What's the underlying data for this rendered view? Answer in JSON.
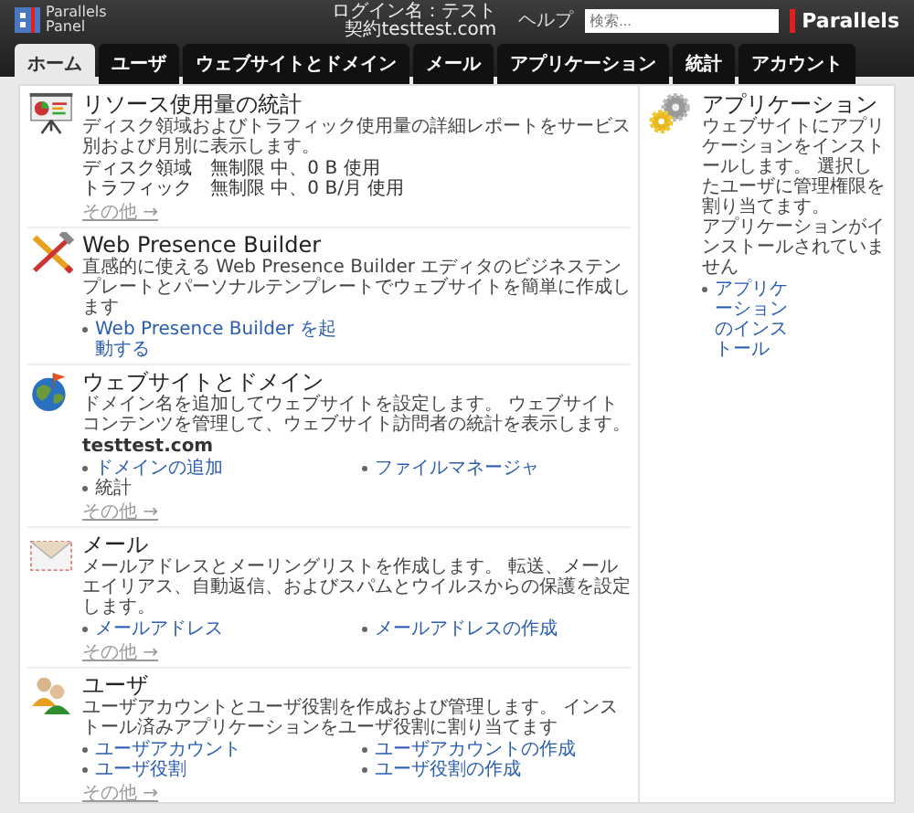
{
  "header": {
    "logo_line1": "Parallels",
    "logo_line2": "Panel",
    "login": "ログイン名：テスト",
    "account": "契約testtest.com",
    "help": "ヘルプ",
    "search": {
      "placeholder": "検索..."
    },
    "brand": "Parallels"
  },
  "tabs": [
    {
      "label": "ホーム",
      "selected": true
    },
    {
      "label": "ユーザ",
      "selected": false
    },
    {
      "label": "ウェブサイトとドメイン",
      "selected": false
    },
    {
      "label": "メール",
      "selected": false
    },
    {
      "label": "アプリケーション",
      "selected": false
    },
    {
      "label": "統計",
      "selected": false
    },
    {
      "label": "アカウント",
      "selected": false
    }
  ],
  "left": [
    {
      "kind": "stats",
      "title": "リソース使用量の統計",
      "description": "ディスク領域およびトラフィック使用量の詳細レポートをサービス別および月別に表示します。",
      "stats": [
        {
          "label": "ディスク領域",
          "value": "無制限 中、0 B 使用"
        },
        {
          "label": "トラフィック",
          "value": "無制限 中、0 B/月 使用"
        }
      ],
      "more": "その他 →"
    },
    {
      "kind": "tools",
      "title": "Web Presence Builder",
      "description": "直感的に使える Web Presence Builder エディタのビジネステンプレートとパーソナルテンプレートでウェブサイトを簡単に作成します",
      "links": [
        {
          "label": "Web Presence Builder を起動する",
          "link": true
        }
      ]
    },
    {
      "kind": "globe",
      "title": "ウェブサイトとドメイン",
      "description": "ドメイン名を追加してウェブサイトを設定します。 ウェブサイトコンテンツを管理して、ウェブサイト訪問者の統計を表示します。",
      "domain": "testtest.com",
      "links": [
        {
          "label": "ドメインの追加",
          "link": true
        },
        {
          "label": "ファイルマネージャ",
          "link": true
        },
        {
          "label": "統計",
          "link": false
        }
      ],
      "more": "その他 →"
    },
    {
      "kind": "mail",
      "title": "メール",
      "description": "メールアドレスとメーリングリストを作成します。 転送、メールエイリアス、自動返信、およびスパムとウイルスからの保護を設定します。",
      "links": [
        {
          "label": "メールアドレス",
          "link": true
        },
        {
          "label": "メールアドレスの作成",
          "link": true
        }
      ],
      "more": "その他 →"
    },
    {
      "kind": "users",
      "title": "ユーザ",
      "description": "ユーザアカウントとユーザ役割を作成および管理します。 インストール済みアプリケーションをユーザ役割に割り当てます",
      "links": [
        {
          "label": "ユーザアカウント",
          "link": true
        },
        {
          "label": "ユーザアカウントの作成",
          "link": true
        },
        {
          "label": "ユーザ役割",
          "link": true
        },
        {
          "label": "ユーザ役割の作成",
          "link": true
        }
      ],
      "more": "その他 →"
    }
  ],
  "right": [
    {
      "kind": "gears",
      "title": "アプリケーション",
      "description": "ウェブサイトにアプリケーションをインストールします。 選択したユーザに管理権限を割り当てます。",
      "note": "アプリケーションがインストールされていません",
      "links": [
        {
          "label": "アプリケーションのインストール",
          "link": true
        }
      ]
    }
  ]
}
